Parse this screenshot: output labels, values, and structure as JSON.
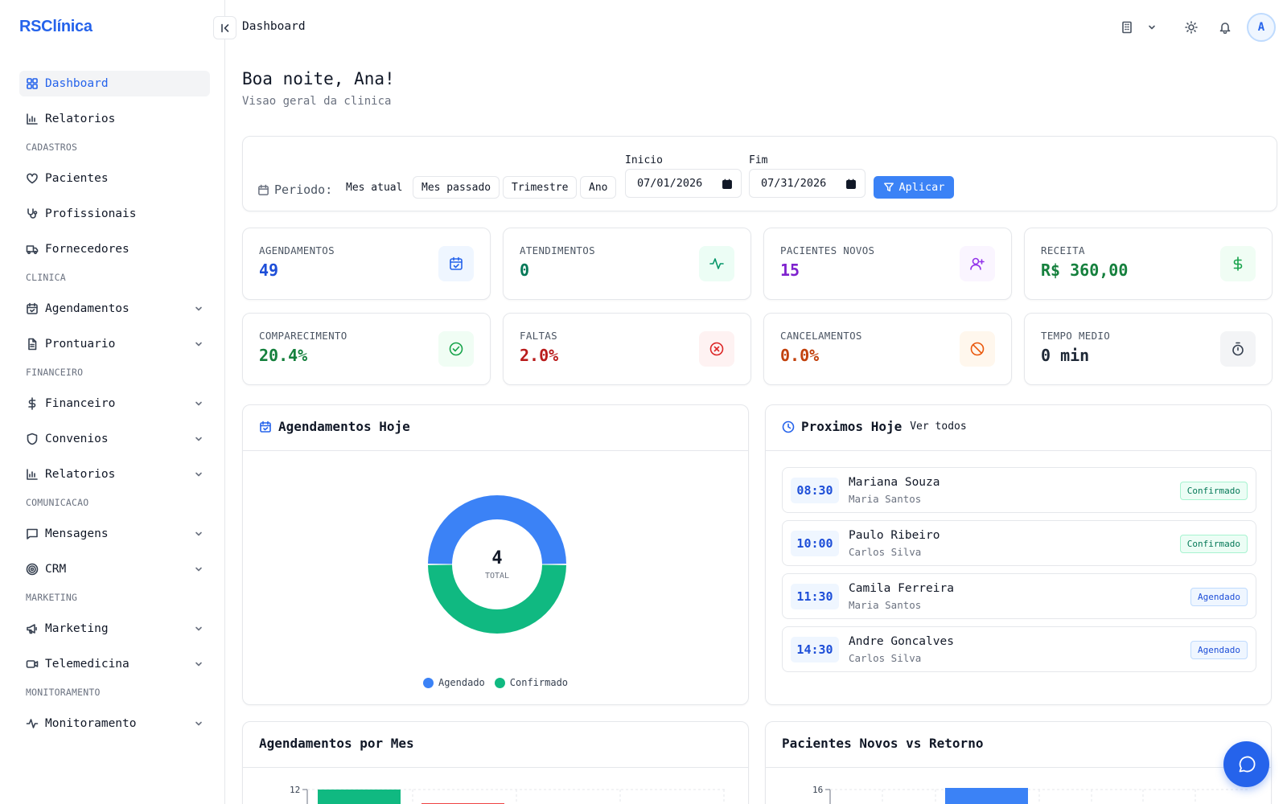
{
  "app": {
    "logo": "RSClínica"
  },
  "sidebar": {
    "items": [
      {
        "label": "Dashboard"
      },
      {
        "label": "Relatorios"
      },
      {
        "label": "Pacientes"
      },
      {
        "label": "Profissionais"
      },
      {
        "label": "Fornecedores"
      },
      {
        "label": "Agendamentos"
      },
      {
        "label": "Prontuario"
      },
      {
        "label": "Financeiro"
      },
      {
        "label": "Convenios"
      },
      {
        "label": "Relatorios"
      },
      {
        "label": "Mensagens"
      },
      {
        "label": "CRM"
      },
      {
        "label": "Marketing"
      },
      {
        "label": "Telemedicina"
      },
      {
        "label": "Monitoramento"
      }
    ],
    "sections": [
      "CADASTROS",
      "CLINICA",
      "FINANCEIRO",
      "COMUNICACAO",
      "MARKETING",
      "MONITORAMENTO"
    ]
  },
  "header": {
    "title": "Dashboard",
    "avatar_initial": "A"
  },
  "welcome": {
    "greeting": "Boa noite, Ana!",
    "subtitle": "Visao geral da clinica"
  },
  "filter": {
    "period_label": "Periodo:",
    "periods": [
      "Mes atual",
      "Mes passado",
      "Trimestre",
      "Ano"
    ],
    "start_label": "Inicio",
    "start_value": "07/01/2026",
    "end_label": "Fim",
    "end_value": "07/31/2026",
    "apply_label": "Aplicar"
  },
  "kpis": [
    {
      "label": "AGENDAMENTOS",
      "value": "49",
      "color": "#1d4ed8"
    },
    {
      "label": "ATENDIMENTOS",
      "value": "0",
      "color": "#047857"
    },
    {
      "label": "PACIENTES NOVOS",
      "value": "15",
      "color": "#7e22ce"
    },
    {
      "label": "RECEITA",
      "value": "R$ 360,00",
      "color": "#15803d"
    },
    {
      "label": "COMPARECIMENTO",
      "value": "20.4%",
      "color": "#15803d"
    },
    {
      "label": "FALTAS",
      "value": "2.0%",
      "color": "#b91c1c"
    },
    {
      "label": "CANCELAMENTOS",
      "value": "0.0%",
      "color": "#c2410c"
    },
    {
      "label": "TEMPO MEDIO",
      "value": "0 min",
      "color": "#1f2937"
    }
  ],
  "today_panel": {
    "title": "Agendamentos Hoje",
    "total": "4",
    "total_label": "TOTAL"
  },
  "chart_data": {
    "type": "pie",
    "categories": [
      "Agendado",
      "Confirmado"
    ],
    "values": [
      2,
      2
    ],
    "colors": [
      "#3b82f6",
      "#10b981"
    ],
    "legend": "bottom"
  },
  "next_panel": {
    "title": "Proximos Hoje",
    "link": "Ver todos",
    "items": [
      {
        "time": "08:30",
        "patient": "Mariana Souza",
        "doctor": "Maria Santos",
        "status": "Confirmado",
        "kind": "ok"
      },
      {
        "time": "10:00",
        "patient": "Paulo Ribeiro",
        "doctor": "Carlos Silva",
        "status": "Confirmado",
        "kind": "ok"
      },
      {
        "time": "11:30",
        "patient": "Camila Ferreira",
        "doctor": "Maria Santos",
        "status": "Agendado",
        "kind": "ag"
      },
      {
        "time": "14:30",
        "patient": "Andre Goncalves",
        "doctor": "Carlos Silva",
        "status": "Agendado",
        "kind": "ag"
      }
    ]
  },
  "monthly_panel": {
    "title": "Agendamentos por Mes",
    "y_top": "12"
  },
  "returns_panel": {
    "title": "Pacientes Novos vs Retorno",
    "y_top": "16"
  }
}
